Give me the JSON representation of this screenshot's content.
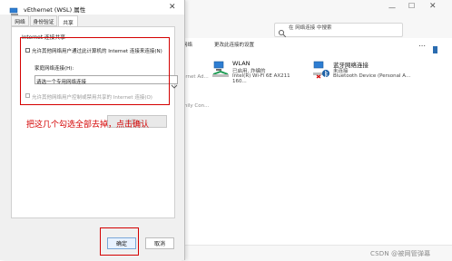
{
  "explorer": {
    "search_placeholder": "在 网络连接 中搜索",
    "toolbar": {
      "left_cut": "网络",
      "rename_connection": "更改此连接的设置",
      "more_glyph": "⋯"
    },
    "connections": [
      {
        "name": "WLAN",
        "status": "已启用, 炸编的",
        "device": "Intel(R) Wi-Fi 6E AX211 160..."
      },
      {
        "name": "蓝牙网络连接",
        "status": "未连接",
        "device": "Bluetooth Device (Personal A..."
      }
    ],
    "partials": {
      "left_item_1": "ernet Ad...",
      "left_item_2": "mily Con..."
    },
    "watermark": "CSDN @被网管弹幕"
  },
  "dialog": {
    "title": "vEthernet (WSL) 属性",
    "close_glyph": "✕",
    "tabs": [
      "网络",
      "身份验证",
      "共享"
    ],
    "active_tab_index": 2,
    "ics": {
      "heading": "Internet 连接共享",
      "allow_sharing": {
        "label": "允许其他网络用户通过此计算机的 Internet 连接来连接(N)",
        "checked": false
      },
      "home_network": {
        "label": "家庭网络连接(H):",
        "value": "请选一个专用网络连接"
      },
      "allow_control": {
        "label": "允许其他网络用户控制或禁用共享的 Internet 连接(O)",
        "checked": false
      },
      "settings_button_label": "设置(G)..."
    },
    "annotation": {
      "text": "把这几个勾选全部去掉，点击确认",
      "color": "#d40000"
    },
    "buttons": {
      "ok": "确定",
      "cancel": "取消"
    }
  }
}
